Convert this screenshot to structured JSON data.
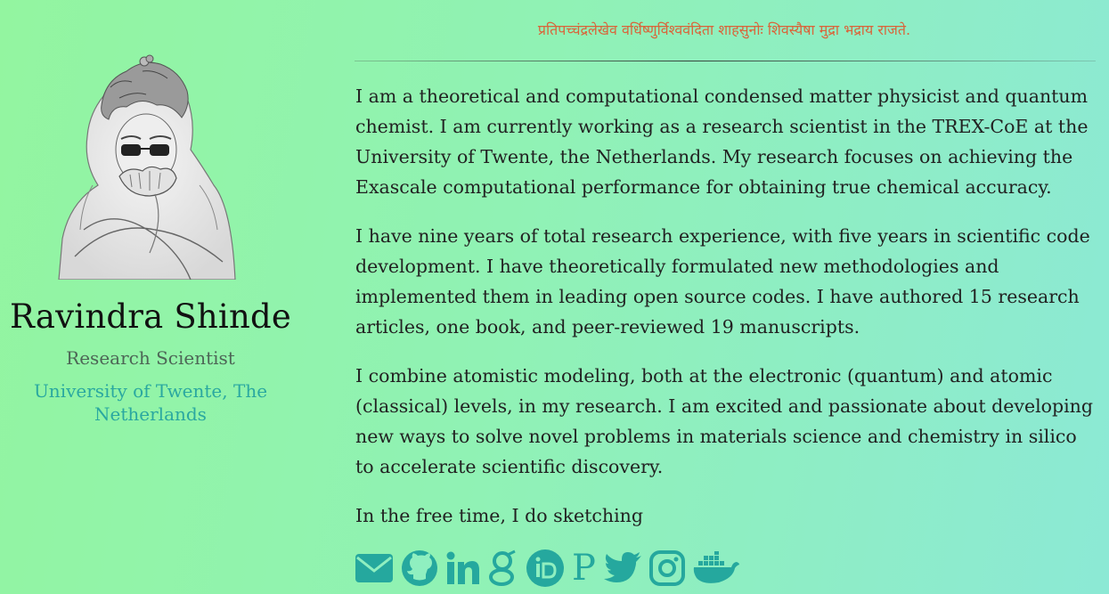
{
  "profile": {
    "name": "Ravindra Shinde",
    "role": "Research Scientist",
    "affiliation": "University of Twente, The Netherlands"
  },
  "motto": "प्रतिपच्चंद्रलेखेव वर्धिष्णुर्विश्ववंदिता शाहसुनोः शिवस्यैषा मुद्रा भद्राय राजते.",
  "about": {
    "paragraphs": [
      "I am a theoretical and computational condensed matter physicist and quantum chemist. I am currently working as a research scientist in the TREX-CoE at the University of Twente, the Netherlands. My research focuses on achieving the Exascale computational performance for obtaining true chemical accuracy.",
      "I have nine years of total research experience, with five years in scientific code development. I have theoretically formulated new methodologies and implemented them in leading open source codes. I have authored 15 research articles, one book, and peer-reviewed 19 manuscripts.",
      "I combine atomistic modeling, both at the electronic (quantum) and atomic (classical) levels, in my research. I am excited and passionate about developing new ways to solve novel problems in materials science and chemistry in silico to accelerate scientific discovery.",
      "In the free time, I do sketching"
    ]
  },
  "social": {
    "icons": [
      "email-icon",
      "github-icon",
      "linkedin-icon",
      "google-scholar-icon",
      "orcid-icon",
      "publons-icon",
      "twitter-icon",
      "instagram-icon",
      "docker-icon"
    ],
    "publons_glyph": "P"
  },
  "colors": {
    "accent": "#25a89e",
    "motto": "#d9643a",
    "affiliation": "#2aa8a0",
    "background_start": "#93f5a0",
    "background_end": "#8ce9d5"
  }
}
